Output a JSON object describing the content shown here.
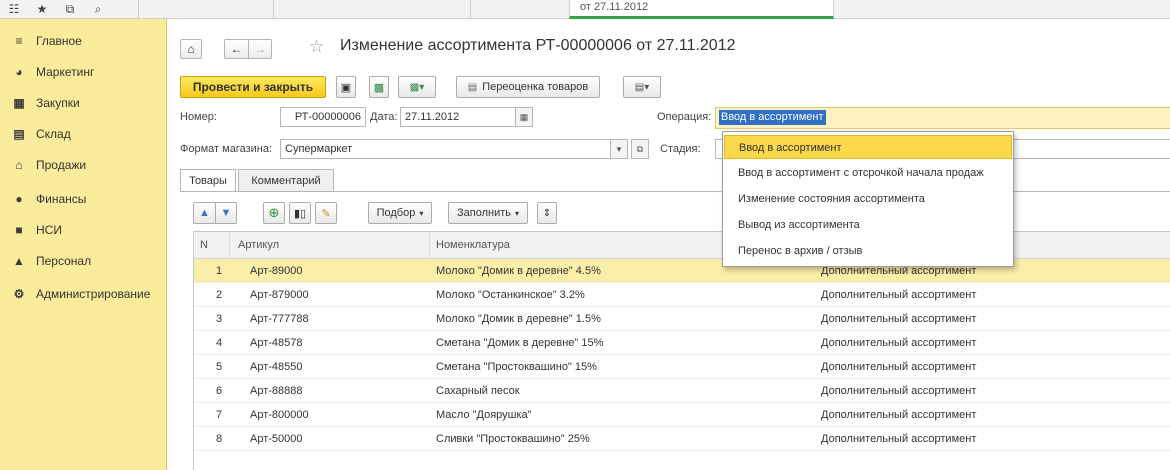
{
  "topbar": {
    "tools": [
      {
        "icon": "grid-icon",
        "glyph": "☷"
      },
      {
        "icon": "star-icon",
        "glyph": "★"
      },
      {
        "icon": "history-icon",
        "glyph": "⧉"
      },
      {
        "icon": "search-icon",
        "glyph": "⌕"
      }
    ],
    "open_tab_text": "от 27.11.2012"
  },
  "sidebar": {
    "items": [
      {
        "label": "Главное",
        "icon": "menu-lines-icon",
        "glyph": "≡"
      },
      {
        "label": "Маркетинг",
        "icon": "pie-chart-icon",
        "glyph": "◕"
      },
      {
        "label": "Закупки",
        "icon": "cart-icon",
        "glyph": "▦"
      },
      {
        "label": "Склад",
        "icon": "warehouse-icon",
        "glyph": "▤"
      },
      {
        "label": "Продажи",
        "icon": "shop-icon",
        "glyph": "⌂"
      },
      {
        "label": "Финансы",
        "icon": "coin-icon",
        "glyph": "●"
      },
      {
        "label": "НСИ",
        "icon": "book-icon",
        "glyph": "■"
      },
      {
        "label": "Персонал",
        "icon": "person-icon",
        "glyph": "▲"
      },
      {
        "label": "Администрирование",
        "icon": "gear-icon",
        "glyph": "⚙"
      }
    ]
  },
  "header": {
    "title": "Изменение ассортимента РТ-00000006 от 27.11.2012"
  },
  "toolbar": {
    "post_close_label": "Провести и закрыть",
    "revaluation_label": "Переоценка товаров"
  },
  "form": {
    "number_label": "Номер:",
    "number_value": "РТ-00000006",
    "date_label": "Дата:",
    "date_value": "27.11.2012",
    "operation_label": "Операция:",
    "operation_value": "Ввод в ассортимент",
    "format_label": "Формат магазина:",
    "format_value": "Супермаркет",
    "stage_label": "Стадия:"
  },
  "tabs": [
    {
      "label": "Товары"
    },
    {
      "label": "Комментарий"
    }
  ],
  "table_toolbar": {
    "select_label": "Подбор",
    "fill_label": "Заполнить"
  },
  "table": {
    "headers": [
      "N",
      "Артикул",
      "Номенклатура"
    ],
    "rows": [
      {
        "n": "1",
        "article": "Арт-89000",
        "name": "Молоко \"Домик в деревне\" 4.5%",
        "type": "Дополнительный ассортимент"
      },
      {
        "n": "2",
        "article": "Арт-879000",
        "name": "Молоко \"Останкинское\" 3.2%",
        "type": "Дополнительный ассортимент"
      },
      {
        "n": "3",
        "article": "Арт-777788",
        "name": "Молоко \"Домик в деревне\" 1.5%",
        "type": "Дополнительный ассортимент"
      },
      {
        "n": "4",
        "article": "Арт-48578",
        "name": "Сметана \"Домик в деревне\" 15%",
        "type": "Дополнительный ассортимент"
      },
      {
        "n": "5",
        "article": "Арт-48550",
        "name": "Сметана \"Простоквашино\" 15%",
        "type": "Дополнительный ассортимент"
      },
      {
        "n": "6",
        "article": "Арт-88888",
        "name": "Сахарный песок",
        "type": "Дополнительный ассортимент"
      },
      {
        "n": "7",
        "article": "Арт-800000",
        "name": "Масло \"Доярушка\"",
        "type": "Дополнительный ассортимент"
      },
      {
        "n": "8",
        "article": "Арт-50000",
        "name": "Сливки \"Простоквашино\" 25%",
        "type": "Дополнительный ассортимент"
      }
    ]
  },
  "dropdown": {
    "options": [
      "Ввод в ассортимент",
      "Ввод в ассортимент с отсрочкой начала продаж",
      "Изменение состояния ассортимента",
      "Вывод из ассортимента",
      "Перенос в архив / отзыв"
    ]
  },
  "colors": {
    "sidebar_bg": "#fbec9b",
    "primary_button": "#f4c91b",
    "selected_row": "#fbeea8",
    "highlight_option": "#fad84a",
    "selection_blue": "#3170c6",
    "active_tab_underline": "#3aa14a"
  }
}
